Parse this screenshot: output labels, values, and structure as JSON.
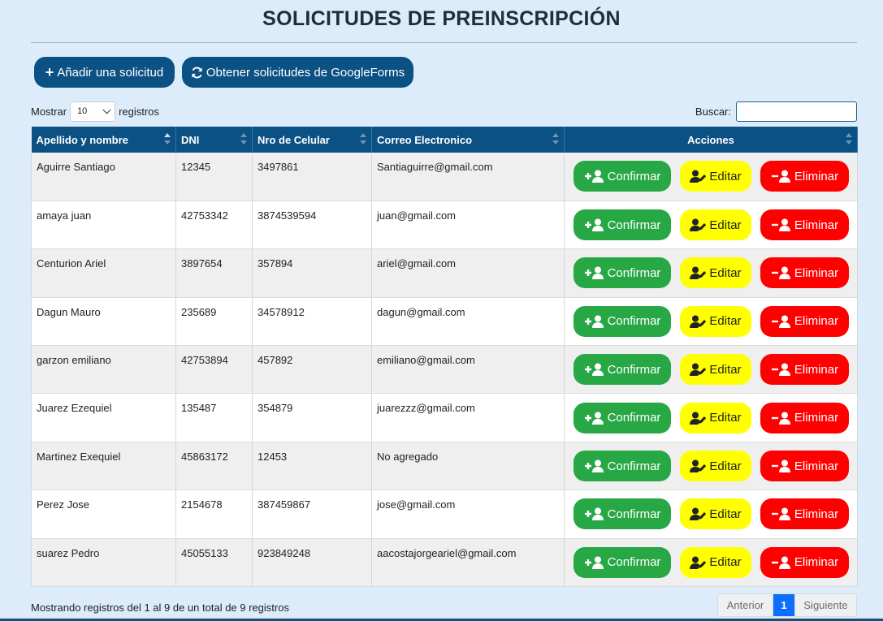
{
  "page": {
    "title": "SOLICITUDES DE PREINSCRIPCIÓN"
  },
  "toolbar": {
    "add_label": "Añadir una solicitud",
    "google_label": "Obtener solicitudes de GoogleForms"
  },
  "length_control": {
    "prefix": "Mostrar",
    "value": "10",
    "suffix": "registros"
  },
  "search": {
    "label": "Buscar:",
    "value": ""
  },
  "table": {
    "headers": [
      "Apellido y nombre",
      "DNI",
      "Nro de Celular",
      "Correo Electronico",
      "Acciones"
    ],
    "rows": [
      {
        "name": "Aguirre Santiago",
        "dni": "12345",
        "phone": "3497861",
        "email": "Santiaguirre@gmail.com"
      },
      {
        "name": "amaya juan",
        "dni": "42753342",
        "phone": "3874539594",
        "email": "juan@gmail.com"
      },
      {
        "name": "Centurion Ariel",
        "dni": "3897654",
        "phone": "357894",
        "email": "ariel@gmail.com"
      },
      {
        "name": "Dagun Mauro",
        "dni": "235689",
        "phone": "34578912",
        "email": "dagun@gmail.com"
      },
      {
        "name": "garzon emiliano",
        "dni": "42753894",
        "phone": "457892",
        "email": "emiliano@gmail.com"
      },
      {
        "name": "Juarez Ezequiel",
        "dni": "135487",
        "phone": "354879",
        "email": "juarezzz@gmail.com"
      },
      {
        "name": "Martinez Exequiel",
        "dni": "45863172",
        "phone": "12453",
        "email": "No agregado"
      },
      {
        "name": "Perez Jose",
        "dni": "2154678",
        "phone": "387459867",
        "email": "jose@gmail.com"
      },
      {
        "name": "suarez Pedro",
        "dni": "45055133",
        "phone": "923849248",
        "email": "aacostajorgeariel@gmail.com"
      }
    ]
  },
  "actions": {
    "confirm": "Confirmar",
    "edit": "Editar",
    "delete": "Eliminar"
  },
  "footer": {
    "info": "Mostrando registros del 1 al 9 de un total de 9 registros"
  },
  "pagination": {
    "prev": "Anterior",
    "current": "1",
    "next": "Siguiente"
  },
  "colors": {
    "background": "#dcecfb",
    "primary": "#0b5184",
    "confirm": "#28a745",
    "edit": "#ffff00",
    "delete": "#ff0000",
    "page_active": "#0d6efd"
  },
  "icons": {
    "add": "plus-icon",
    "refresh": "refresh-icon",
    "confirm": "user-plus-icon",
    "edit": "user-pen-icon",
    "delete": "user-minus-icon"
  }
}
